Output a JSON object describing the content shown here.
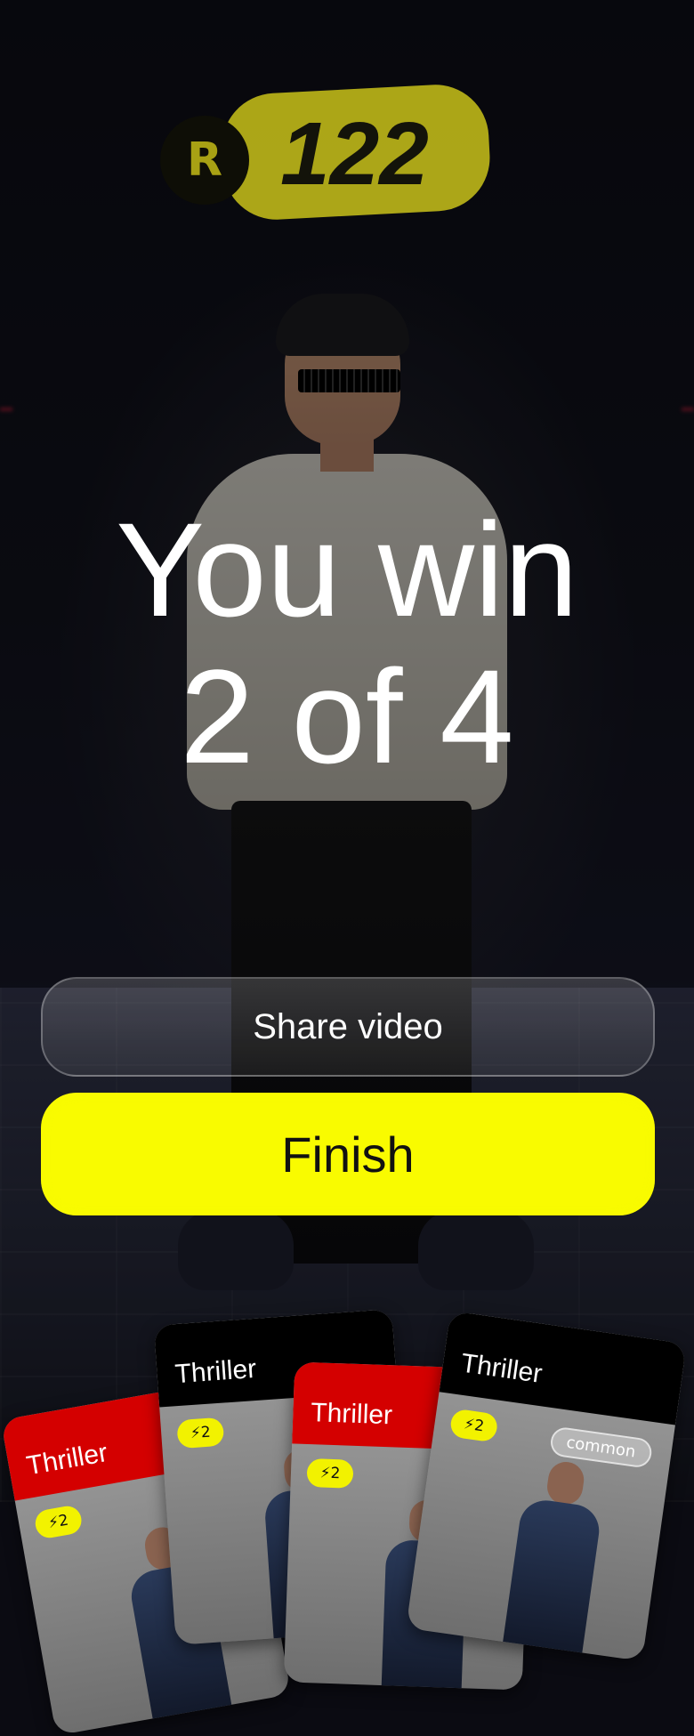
{
  "hud": {
    "coin_icon_name": "coin-icon",
    "coin_letter": "R",
    "coins": "122"
  },
  "result": {
    "line1": "You win",
    "line2": "2 of 4"
  },
  "buttons": {
    "share_label": "Share video",
    "finish_label": "Finish"
  },
  "cards": [
    {
      "title": "Thriller",
      "energy": "2",
      "rarity": "",
      "color": "#d40000"
    },
    {
      "title": "Thriller",
      "energy": "2",
      "rarity": "",
      "color": "#000000"
    },
    {
      "title": "Thriller",
      "energy": "2",
      "rarity": "",
      "color": "#d40000"
    },
    {
      "title": "Thriller",
      "energy": "2",
      "rarity": "common",
      "color": "#000000"
    }
  ],
  "colors": {
    "accent_yellow": "#f9fb00",
    "card_red": "#d40000"
  }
}
